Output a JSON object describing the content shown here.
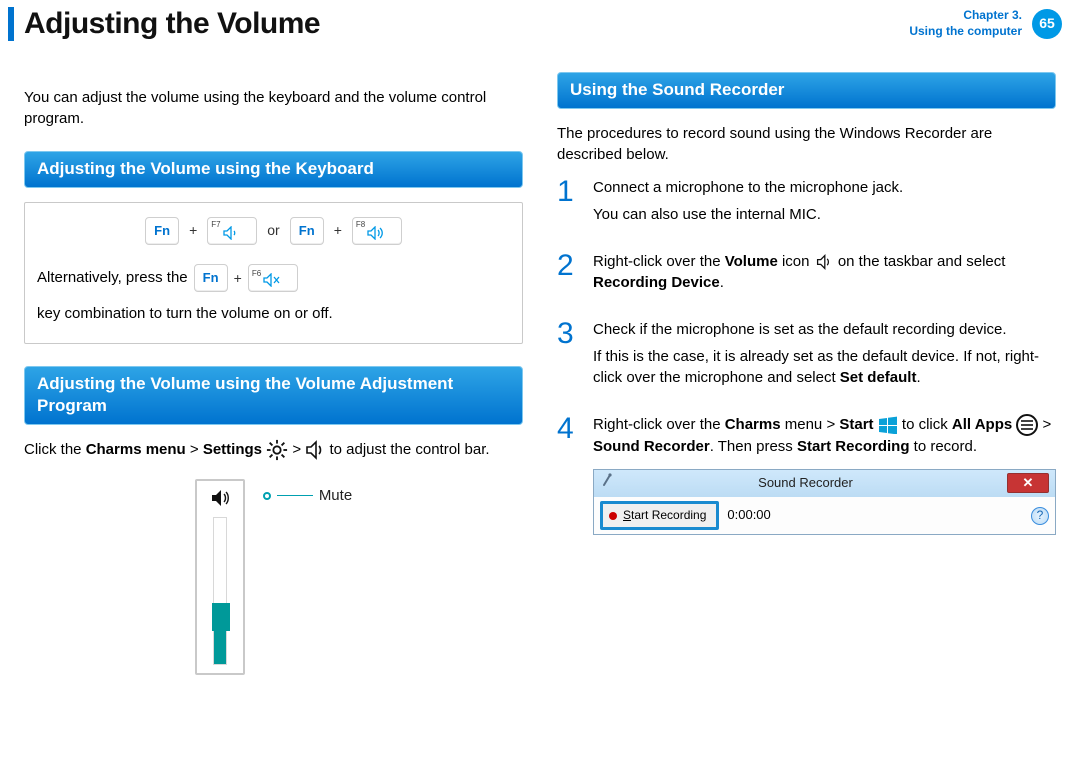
{
  "header": {
    "title": "Adjusting the Volume",
    "chapter_line1": "Chapter 3.",
    "chapter_line2": "Using the computer",
    "page_number": "65"
  },
  "left": {
    "intro": "You can adjust the volume using the keyboard and the volume control program.",
    "sec1_heading": "Adjusting the Volume using the Keyboard",
    "keys": {
      "fn": "Fn",
      "f7": "F7",
      "f8": "F8",
      "f6": "F6",
      "plus": "+",
      "or": "or"
    },
    "alt1a": "Alternatively, press the ",
    "alt1b": " key combination to turn the volume on or off.",
    "sec2_heading": "Adjusting the Volume using the Volume Adjustment Program",
    "click_text_a": "Click the ",
    "charms_menu": "Charms menu",
    "gt": " > ",
    "settings": "Settings",
    "click_text_b": " to adjust the control bar.",
    "mute_label": "Mute"
  },
  "right": {
    "sec_heading": "Using the Sound Recorder",
    "intro": "The procedures to record sound using the Windows Recorder are described below.",
    "step1a": "Connect a microphone to the microphone jack.",
    "step1b": "You can also use the internal MIC.",
    "step2_a": "Right-click over the ",
    "step2_vol": "Volume",
    "step2_icon_after": " icon ",
    "step2_b": " on the taskbar and select ",
    "step2_recdev": "Recording Device",
    "step2_period": ".",
    "step3a": "Check if the microphone is set as the default recording device.",
    "step3b_a": "If this is the case, it is already set as the default device. If not, right-click over the microphone and select ",
    "step3b_bold": "Set default",
    "step3b_c": ".",
    "step4_a": "Right-click over the ",
    "step4_charms": "Charms",
    "step4_menu": " menu > ",
    "step4_start": "Start",
    "step4_b": " to click ",
    "step4_allapps": "All Apps",
    "step4_c": " > ",
    "step4_sr": "Sound Recorder",
    "step4_d": ". Then press ",
    "step4_startrec": "Start Recording",
    "step4_e": " to record.",
    "nums": {
      "n1": "1",
      "n2": "2",
      "n3": "3",
      "n4": "4"
    },
    "recorder": {
      "title": "Sound Recorder",
      "button_prefix": "S",
      "button_rest": "tart Recording",
      "time": "0:00:00",
      "help": "?",
      "close_x": "✕"
    }
  }
}
